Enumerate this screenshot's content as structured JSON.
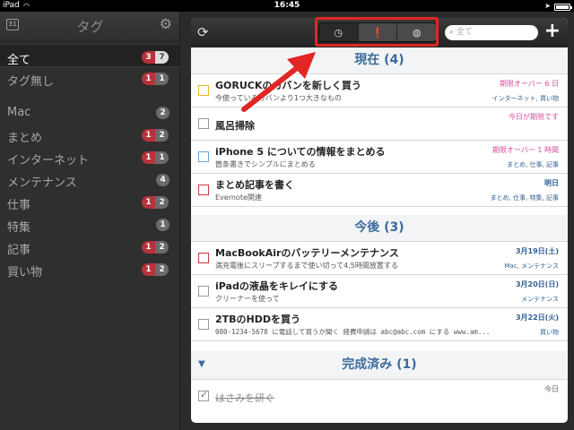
{
  "status": {
    "carrier": "iPad",
    "time": "16:45"
  },
  "sidebar": {
    "title": "タグ",
    "items": [
      {
        "label": "全て",
        "a": "3",
        "b": "7",
        "active": true
      },
      {
        "label": "タグ無し",
        "a": "1",
        "b": "1"
      },
      {
        "label": "Mac",
        "b": "2"
      },
      {
        "label": "まとめ",
        "a": "1",
        "b": "2"
      },
      {
        "label": "インターネット",
        "a": "1",
        "b": "1"
      },
      {
        "label": "メンテナンス",
        "b": "4"
      },
      {
        "label": "仕事",
        "a": "1",
        "b": "2"
      },
      {
        "label": "特集",
        "b": "1"
      },
      {
        "label": "記事",
        "a": "1",
        "b": "2"
      },
      {
        "label": "買い物",
        "a": "1",
        "b": "2"
      }
    ]
  },
  "toolbar": {
    "search_placeholder": "全て"
  },
  "sections": {
    "current": "現在 (4)",
    "later": "今後 (3)",
    "done": "完成済み (1)"
  },
  "tasks": [
    {
      "title": "GORUCKのカバンを新しく買う",
      "sub": "今使っているカバンより1つ大きなもの",
      "date": "期限オーバー 6 日",
      "tags": "インターネット, 買い物"
    },
    {
      "title": "風呂掃除",
      "sub": "",
      "date": "今日が期限です",
      "tags": ""
    },
    {
      "title": "iPhone 5 についての情報をまとめる",
      "sub": "箇条書きでシンプルにまとめる",
      "date": "期限オーバー 1 時間",
      "tags": "まとめ, 仕事, 記事"
    },
    {
      "title": "まとめ記事を書く",
      "sub": "Evernote関連",
      "date": "明日",
      "tags": "まとめ, 仕事, 特集, 記事"
    },
    {
      "title": "MacBookAirのバッテリーメンテナンス",
      "sub": "満充電後にスリープするまで使い切って4,5時間放置する",
      "date": "3月19日(土)",
      "tags": "Mac, メンテナンス"
    },
    {
      "title": "iPadの液晶をキレイにする",
      "sub": "クリーナーを使って",
      "date": "3月20日(日)",
      "tags": "メンテナンス"
    },
    {
      "title": "2TBのHDDを買う",
      "sub": "080-1234-5678 に電話して買うか聞く 経費申請は abc@abc.com にする www.am...",
      "date": "3月22日(火)",
      "tags": "買い物"
    },
    {
      "title": "はさみを研ぐ",
      "sub": "",
      "date": "今日",
      "tags": ""
    }
  ]
}
